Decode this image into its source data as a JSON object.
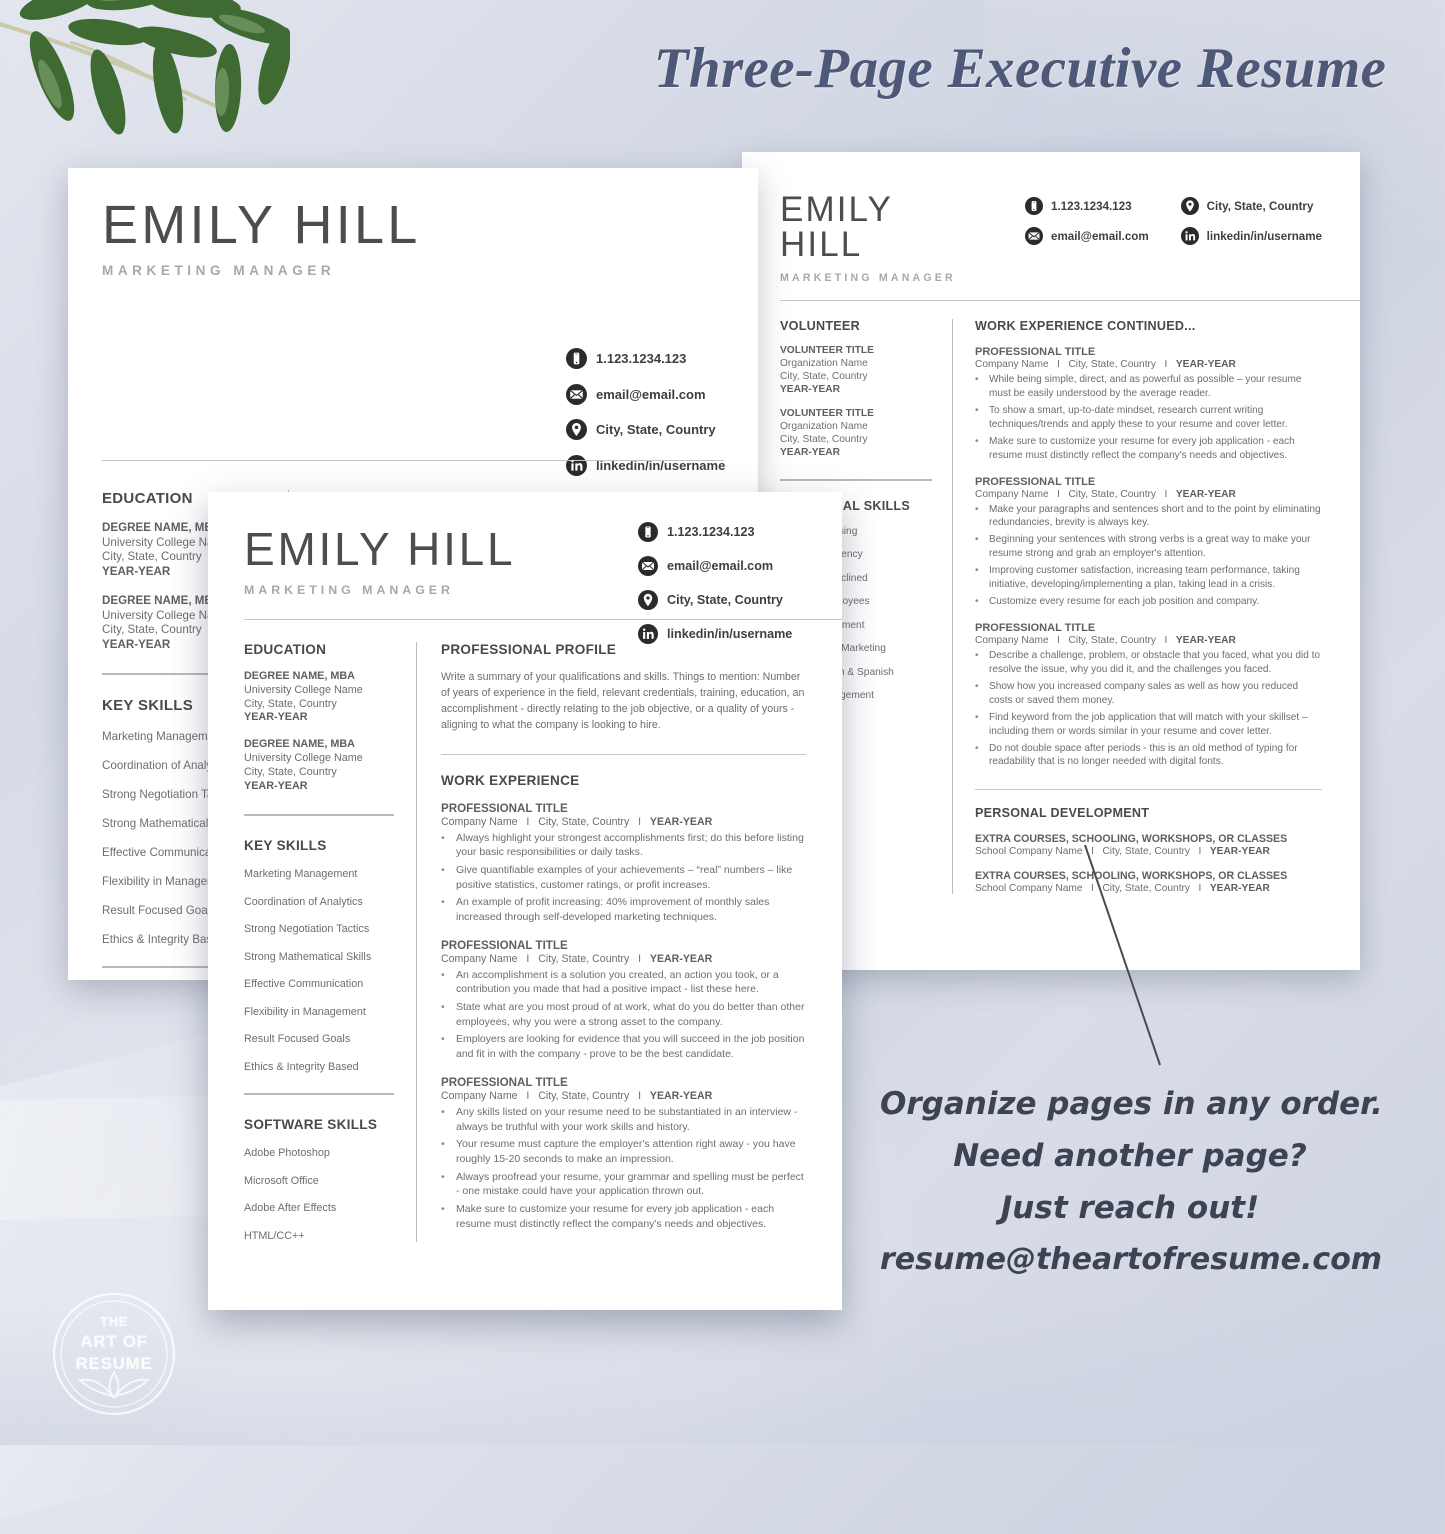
{
  "headline": "Three-Page Executive Resume",
  "promo": {
    "line1": "Organize pages in any order.",
    "line2": "Need another page?",
    "line3": "Just reach out!",
    "line4": "resume@theartofresume.com"
  },
  "logo": {
    "line1": "THE",
    "line2": "ART OF",
    "line3": "RESUME"
  },
  "colors": {
    "headline": "#4e5878",
    "promo": "#3d4352",
    "background": "#d5dae6",
    "paper": "#ffffff",
    "name": "#4d4d4d",
    "role": "#a8a8a8",
    "body": "#6e6e6e",
    "icon": "#2b2b2b"
  },
  "resume": {
    "name": "EMILY HILL",
    "role": "MARKETING MANAGER",
    "contact": {
      "phone": "1.123.1234.123",
      "email": "email@email.com",
      "location": "City, State, Country",
      "linkedin": "linkedin/in/username"
    },
    "sections": {
      "education": "EDUCATION",
      "profile": "PROFESSIONAL PROFILE",
      "work": "WORK EXPERIENCE",
      "work_continued": "WORK EXPERIENCE CONTINUED...",
      "key_skills": "KEY SKILLS",
      "software_skills": "SOFTWARE SKILLS",
      "additional_skills": "ADDITIONAL SKILLS",
      "volunteer": "VOLUNTEER",
      "personal_development": "PERSONAL DEVELOPMENT"
    },
    "education": [
      {
        "degree": "DEGREE NAME, MBA",
        "school": "University College Name",
        "location": "City, State, Country",
        "years": "YEAR-YEAR"
      },
      {
        "degree": "DEGREE NAME, MBA",
        "school": "University College Name",
        "location": "City, State, Country",
        "years": "YEAR-YEAR"
      }
    ],
    "profile_text": "Write a summary of your qualifications and skills. Things to mention: Number of years of experience in the field, relevant credentials, training, education, an accomplishment - directly relating to the job objective, or a quality of yours - aligning to what the company is looking to hire.",
    "key_skills": [
      "Marketing Management",
      "Coordination of Analytics",
      "Strong Negotiation Tactics",
      "Strong Mathematical Skills",
      "Effective Communication",
      "Flexibility in Management",
      "Result Focused Goals",
      "Ethics & Integrity Based"
    ],
    "software_skills": [
      "Adobe Photoshop",
      "Microsoft Office",
      "Adobe After Effects",
      "HTML/CC++"
    ],
    "additional_skills": [
      "Word Processing",
      "Typing Proficiency",
      "Technically Inclined",
      "Training Employees",
      "Time Management",
      "Social Media Marketing",
      "Fluent English & Spanish",
      "Project Management"
    ],
    "volunteer": [
      {
        "title": "VOLUNTEER TITLE",
        "org": "Organization Name",
        "location": "City, State, Country",
        "years": "YEAR-YEAR"
      },
      {
        "title": "VOLUNTEER TITLE",
        "org": "Organization Name",
        "location": "City, State, Country",
        "years": "YEAR-YEAR"
      }
    ],
    "job_title": "PROFESSIONAL TITLE",
    "job_company": "Company Name",
    "job_location": "City, State, Country",
    "job_years": "YEAR-YEAR",
    "separator": "I",
    "jobs_page1": [
      {
        "bullets": [
          "Always highlight your strongest accomplishments first; do this before listing your basic responsibilities or daily tasks.",
          "Give quantifiable examples of your achievements – “real” numbers – like positive statistics, customer ratings, or profit increases.",
          "An example of profit increasing: 40% improvement of monthly sales increased through self-developed marketing techniques."
        ]
      },
      {
        "bullets": [
          "An accomplishment is a solution you created, an action you took, or a contribution you made that had a positive impact - list these here.",
          "State what are you most proud of at work, what do you do better than other employees, why you were a strong asset to the company.",
          "Employers are looking for evidence that you will succeed in the job position and fit in with the company - prove to be the best candidate."
        ]
      },
      {
        "bullets": [
          "Any skills listed on your resume need to be substantiated in an interview - always be truthful with your work skills and history.",
          "Your resume must capture the employer's attention right away - you have roughly 15-20 seconds to make an impression.",
          "Always proofread your resume, your grammar and spelling must be perfect - one mistake could have your application thrown out.",
          "Make sure to customize your resume for every job application - each resume must distinctly reflect the company's needs and objectives."
        ]
      }
    ],
    "jobs_page2": [
      {
        "bullets": [
          "While being simple, direct, and as powerful as possible – your resume must be easily understood by the average reader.",
          "To show a smart, up-to-date mindset, research current writing techniques/trends and apply these to your resume and cover letter.",
          "Make sure to customize your resume for every job application - each resume must distinctly reflect the company's needs and objectives."
        ]
      },
      {
        "bullets": [
          "Make your paragraphs and sentences short and to the point by eliminating redundancies, brevity is always key.",
          "Beginning your sentences with strong verbs is a great way to make your resume strong and grab an employer's attention.",
          "Improving customer satisfaction, increasing team performance, taking initiative, developing/implementing a plan, taking lead in a crisis.",
          "Customize every resume for each job position and company."
        ]
      },
      {
        "bullets": [
          "Describe a challenge, problem, or obstacle that you faced, what you did to resolve the issue, why you did it, and the challenges you faced.",
          "Show how you increased company sales as well as how you reduced costs or saved them money.",
          "Find keyword from the job application that will match with your skillset – including them or words similar in your resume and cover letter.",
          "Do not double space after periods - this is an old method of typing for readability that is no longer needed with digital fonts."
        ]
      }
    ],
    "personal_development": [
      {
        "title": "EXTRA COURSES, SCHOOLING, WORKSHOPS, OR CLASSES",
        "school": "School Company Name",
        "location": "City, State, Country",
        "years": "YEAR-YEAR"
      },
      {
        "title": "EXTRA COURSES, SCHOOLING, WORKSHOPS, OR CLASSES",
        "school": "School Company Name",
        "location": "City, State, Country",
        "years": "YEAR-YEAR"
      }
    ]
  }
}
